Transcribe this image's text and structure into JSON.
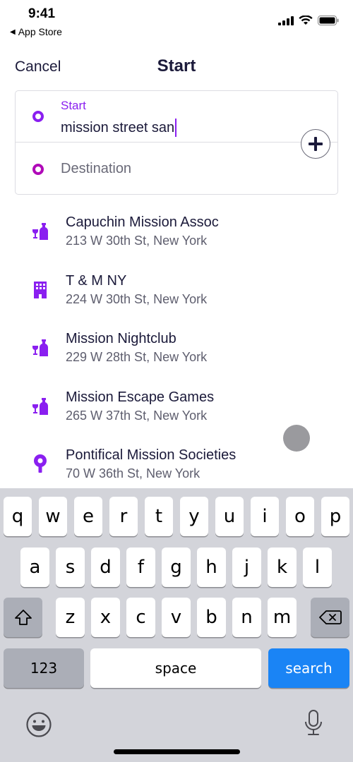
{
  "status_bar": {
    "time": "9:41",
    "back_label": "App Store",
    "icons": [
      "signal-icon",
      "wifi-icon",
      "battery-icon"
    ]
  },
  "nav": {
    "cancel_label": "Cancel",
    "title": "Start"
  },
  "route": {
    "start_label": "Start",
    "start_value": "mission street san",
    "destination_placeholder": "Destination",
    "add_stop_icon": "plus-icon",
    "colors": {
      "start": "#8a1ff0",
      "destination": "#b00ab8"
    }
  },
  "results": [
    {
      "name": "Capuchin Mission Assoc",
      "address": "213 W 30th St, New York",
      "icon": "bar-icon"
    },
    {
      "name": "T & M NY",
      "address": "224 W 30th St, New York",
      "icon": "building-icon"
    },
    {
      "name": "Mission Nightclub",
      "address": "229 W 28th St, New York",
      "icon": "bar-icon"
    },
    {
      "name": "Mission Escape Games",
      "address": "265 W 37th St, New York",
      "icon": "bar-icon"
    },
    {
      "name": "Pontifical Mission Societies",
      "address": "70 W 36th St, New York",
      "icon": "pin-icon"
    }
  ],
  "keyboard": {
    "row1": [
      "q",
      "w",
      "e",
      "r",
      "t",
      "y",
      "u",
      "i",
      "o",
      "p"
    ],
    "row2": [
      "a",
      "s",
      "d",
      "f",
      "g",
      "h",
      "j",
      "k",
      "l"
    ],
    "row3": [
      "z",
      "x",
      "c",
      "v",
      "b",
      "n",
      "m"
    ],
    "numbers_label": "123",
    "space_label": "space",
    "action_label": "search",
    "action_color": "#1a84f5"
  }
}
